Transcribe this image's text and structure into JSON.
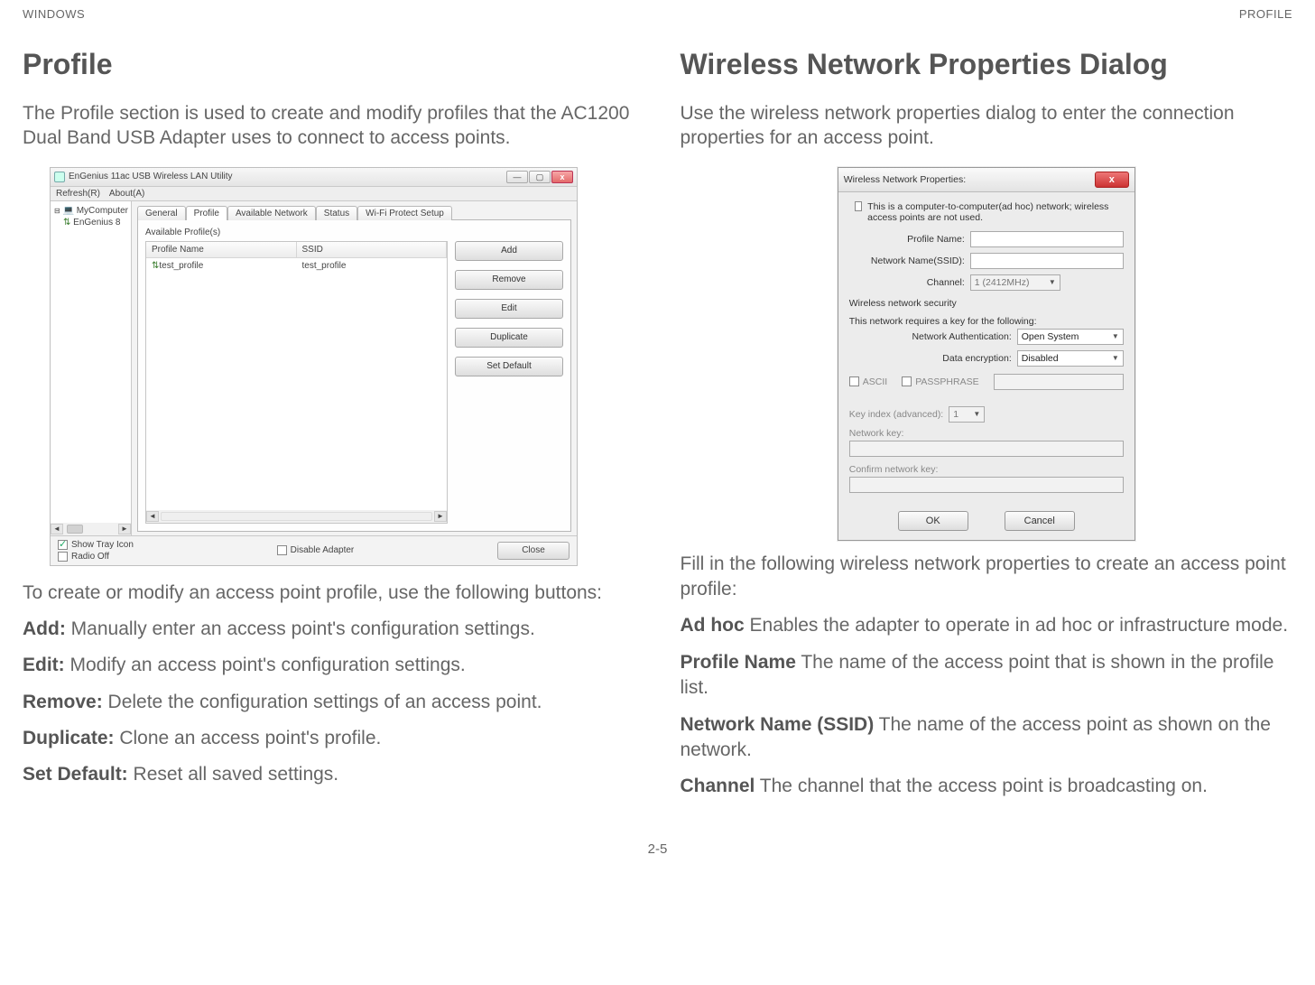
{
  "header": {
    "left": "WINDOWS",
    "right": "PROFILE"
  },
  "left": {
    "heading": "Profile",
    "intro": "The Profile section is used to create and modify profiles that the AC1200 Dual Band USB Adapter uses to connect to access points.",
    "after_figure": "To create or modify an access point profile, use the following buttons:",
    "items": [
      {
        "term": "Add:",
        "desc": " Manually enter an access point's configuration settings."
      },
      {
        "term": "Edit:",
        "desc": " Modify an access point's configuration settings."
      },
      {
        "term": "Remove:",
        "desc": " Delete the configuration settings of an access point."
      },
      {
        "term": "Duplicate:",
        "desc": " Clone an access point's profile."
      },
      {
        "term": "Set Default:",
        "desc": " Reset all saved settings."
      }
    ]
  },
  "right": {
    "heading": "Wireless Network Properties Dialog",
    "intro": "Use the wireless network properties dialog to enter the connection properties for an access point.",
    "after_figure": "Fill in the following wireless network properties to create an access point profile:",
    "items": [
      {
        "term": "Ad hoc",
        "desc": "  Enables the adapter to operate in ad hoc or infrastructure mode."
      },
      {
        "term": "Profile Name",
        "desc": "  The name of the access point that is shown in the profile list."
      },
      {
        "term": "Network Name (SSID)",
        "desc": "  The name of the access point as shown on the network."
      },
      {
        "term": "Channel",
        "desc": "  The channel that the access point is broadcasting on."
      }
    ]
  },
  "utility": {
    "title": "EnGenius 11ac USB Wireless LAN Utility",
    "menu": {
      "refresh": "Refresh(R)",
      "about": "About(A)"
    },
    "tree": {
      "root": "MyComputer",
      "child": "EnGenius 8"
    },
    "tabs": [
      "General",
      "Profile",
      "Available Network",
      "Status",
      "Wi-Fi Protect Setup"
    ],
    "available_label": "Available Profile(s)",
    "list_headers": {
      "name": "Profile Name",
      "ssid": "SSID"
    },
    "list_row": {
      "name": "test_profile",
      "ssid": "test_profile"
    },
    "buttons": {
      "add": "Add",
      "remove": "Remove",
      "edit": "Edit",
      "duplicate": "Duplicate",
      "set_default": "Set Default"
    },
    "footer": {
      "show_tray": "Show Tray Icon",
      "radio_off": "Radio Off",
      "disable_adapter": "Disable Adapter",
      "close": "Close"
    }
  },
  "dialog": {
    "title": "Wireless Network Properties:",
    "adhoc": "This is a computer-to-computer(ad hoc) network; wireless access points are not used.",
    "profile_name": "Profile Name:",
    "ssid": "Network Name(SSID):",
    "channel_label": "Channel:",
    "channel_value": "1 (2412MHz)",
    "security_header": "Wireless network security",
    "security_sub": "This network requires a key for the following:",
    "auth_label": "Network Authentication:",
    "auth_value": "Open System",
    "enc_label": "Data encryption:",
    "enc_value": "Disabled",
    "ascii": "ASCII",
    "passphrase": "PASSPHRASE",
    "key_index": "Key index (advanced):",
    "key_index_value": "1",
    "network_key": "Network key:",
    "confirm_key": "Confirm network key:",
    "ok": "OK",
    "cancel": "Cancel"
  },
  "page_number": "2-5"
}
